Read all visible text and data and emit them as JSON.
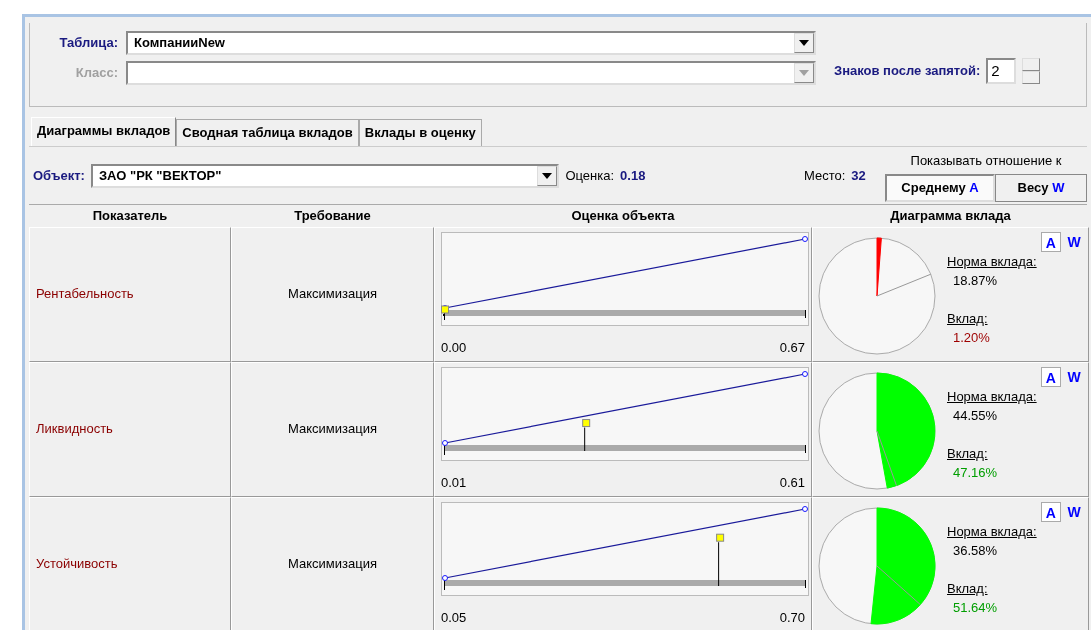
{
  "table_field": {
    "label": "Таблица:",
    "value": "КомпанииNew"
  },
  "class_field": {
    "label": "Класс:",
    "disabled": true
  },
  "decimals": {
    "label": "Знаков после запятой:",
    "value": "2"
  },
  "tabs": [
    {
      "label": "Диаграммы вкладов",
      "selected": true
    },
    {
      "label": "Сводная таблица вкладов",
      "selected": false
    },
    {
      "label": "Вклады в оценку",
      "selected": false
    }
  ],
  "object": {
    "label": "Объект:",
    "value": "ЗАО \"РК \"ВЕКТОР\"",
    "score_label": "Оценка:",
    "score": "0.18",
    "place_label": "Место:",
    "place": "32"
  },
  "ratio": {
    "label": "Показывать отношение к",
    "options": [
      {
        "label": "Среднему",
        "key": "A",
        "selected": true
      },
      {
        "label": "Весу",
        "key": "W",
        "selected": false
      }
    ]
  },
  "columns": [
    "Показатель",
    "Требование",
    "Оценка объекта",
    "Диаграмма вклада"
  ],
  "rows": [
    {
      "name": "Рентабельность",
      "requirement": "Максимизация",
      "min": "0.00",
      "max": "0.67",
      "level": 0.0,
      "toggles": [
        {
          "label": "A",
          "selected": true
        },
        {
          "label": "W",
          "selected": false
        }
      ],
      "norm_label": "Норма вклада:",
      "norm": "18.87%",
      "contrib_label": "Вклад:",
      "contrib": "1.20%",
      "color": "#ff0000"
    },
    {
      "name": "Ликвидность",
      "requirement": "Максимизация",
      "min": "0.01",
      "max": "0.61",
      "level": 0.39,
      "toggles": [
        {
          "label": "A",
          "selected": true
        },
        {
          "label": "W",
          "selected": false
        }
      ],
      "norm_label": "Норма вклада:",
      "norm": "44.55%",
      "contrib_label": "Вклад:",
      "contrib": "47.16%",
      "color": "#00ff00"
    },
    {
      "name": "Устойчивость",
      "requirement": "Максимизация",
      "min": "0.05",
      "max": "0.70",
      "level": 0.76,
      "toggles": [
        {
          "label": "A",
          "selected": true
        },
        {
          "label": "W",
          "selected": false
        }
      ],
      "norm_label": "Норма вклада:",
      "norm": "36.58%",
      "contrib_label": "Вклад:",
      "contrib": "51.64%",
      "color": "#00ff00"
    }
  ]
}
